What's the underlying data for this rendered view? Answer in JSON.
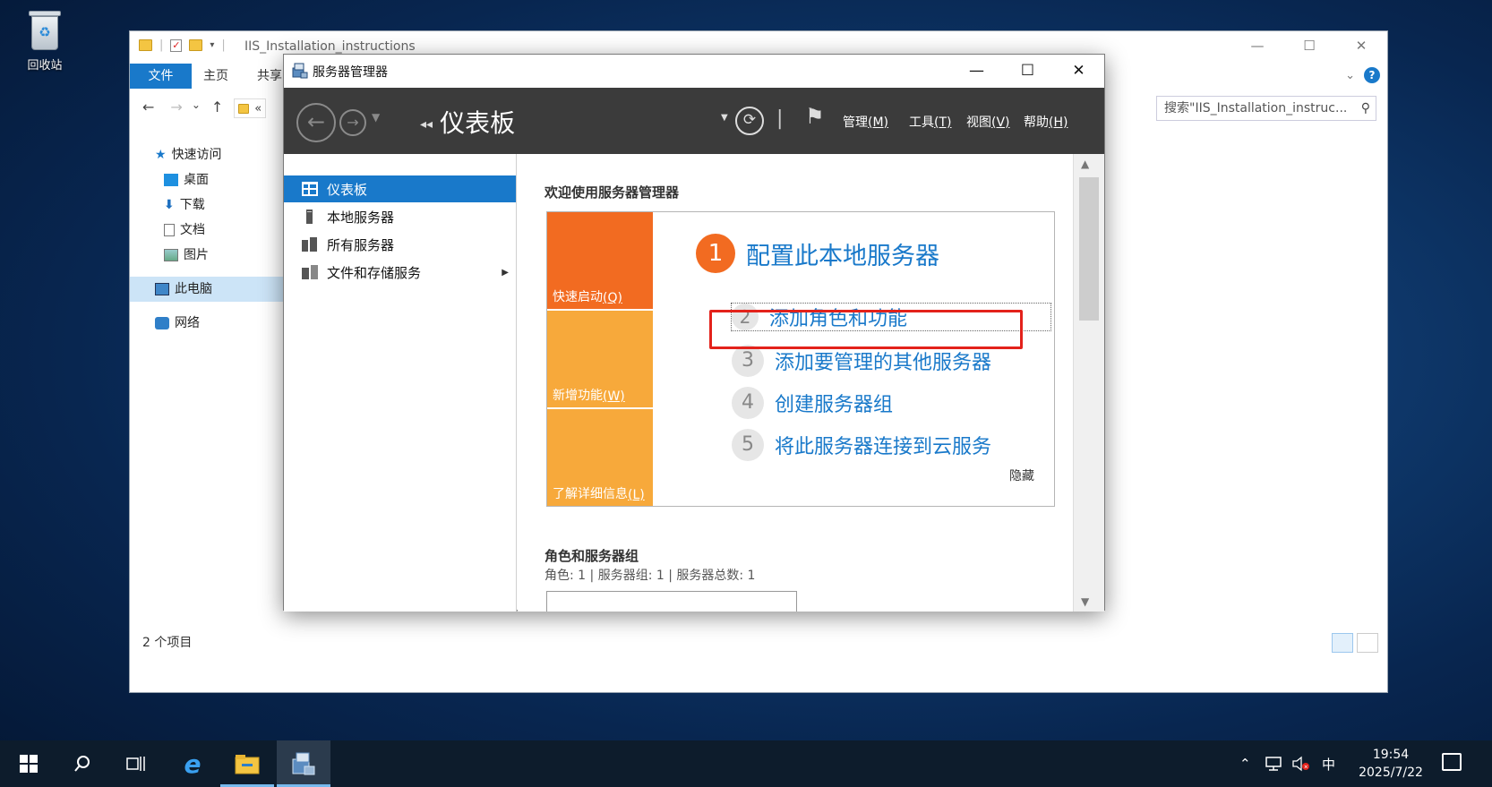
{
  "desktop": {
    "recycle_bin_label": "回收站"
  },
  "explorer": {
    "title": "IIS_Installation_instructions",
    "ribbon": {
      "file": "文件",
      "home": "主页",
      "share": "共享"
    },
    "address_fragment": "«",
    "search_placeholder": "搜索\"IIS_Installation_instruc...",
    "nav": {
      "quick_access": "快速访问",
      "desktop": "桌面",
      "downloads": "下载",
      "documents": "文档",
      "pictures": "图片",
      "this_pc": "此电脑",
      "network": "网络"
    },
    "status": "2 个项目"
  },
  "server_manager": {
    "title": "服务器管理器",
    "breadcrumb": "仪表板",
    "menu": {
      "manage": "管理",
      "manage_key": "(M)",
      "tools": "工具",
      "tools_key": "(T)",
      "view": "视图",
      "view_key": "(V)",
      "help": "帮助",
      "help_key": "(H)"
    },
    "sidebar": [
      {
        "label": "仪表板"
      },
      {
        "label": "本地服务器"
      },
      {
        "label": "所有服务器"
      },
      {
        "label": "文件和存储服务"
      }
    ],
    "welcome": "欢迎使用服务器管理器",
    "tiles": {
      "quick_start": "快速启动",
      "quick_start_key": "(Q)",
      "whats_new": "新增功能",
      "whats_new_key": "(W)",
      "learn_more": "了解详细信息",
      "learn_more_key": "(L)"
    },
    "steps": [
      {
        "num": "1",
        "label": "配置此本地服务器"
      },
      {
        "num": "2",
        "label": "添加角色和功能"
      },
      {
        "num": "3",
        "label": "添加要管理的其他服务器"
      },
      {
        "num": "4",
        "label": "创建服务器组"
      },
      {
        "num": "5",
        "label": "将此服务器连接到云服务"
      }
    ],
    "hide": "隐藏",
    "roles_title": "角色和服务器组",
    "roles_summary": "角色: 1 | 服务器组: 1 | 服务器总数: 1"
  },
  "taskbar": {
    "ime": "中",
    "time": "19:54",
    "date": "2025/7/22"
  },
  "colors": {
    "accent": "#1979ca",
    "orange": "#f26b21",
    "amber": "#f7a93b",
    "highlight": "#e3221b"
  }
}
